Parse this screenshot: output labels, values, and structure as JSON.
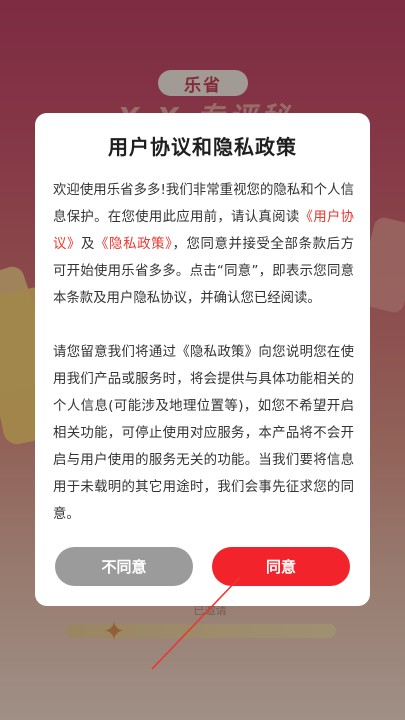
{
  "background": {
    "badge": "乐省",
    "banner": "X X 专评秘",
    "bottom_text": "已邀请"
  },
  "dialog": {
    "title": "用户协议和隐私政策",
    "para1": {
      "t1": "欢迎使用乐省多多!我们非常重视您的隐私和个人信息保护。在您使用此应用前，请认真阅读",
      "link_user_agreement": "《用户协议》",
      "t2": "及",
      "link_privacy_policy": "《隐私政策》",
      "t3": "，您同意并接受全部条款后方可开始使用乐省多多。点击“同意”，即表示您同意本条款及用户隐私协议，并确认您已经阅读。"
    },
    "para2": "请您留意我们将通过《隐私政策》向您说明您在使用我们产品或服务时，将会提供与具体功能相关的个人信息(可能涉及地理位置等)，如您不希望开启相关功能，可停止使用对应服务，本产品将不会开启与用户使用的服务无关的功能。当我们要将信息用于未载明的其它用途时，我们会事先征求您的同意。",
    "disagree_label": "不同意",
    "agree_label": "同意"
  },
  "colors": {
    "accent_red": "#f2232b",
    "link_red": "#e8382f",
    "disagree_gray": "#9b9b9b"
  }
}
